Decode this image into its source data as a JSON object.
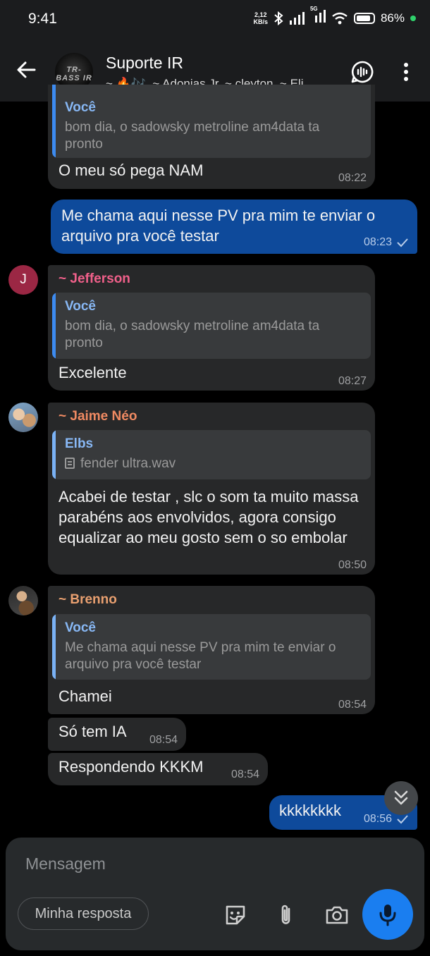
{
  "status_bar": {
    "time": "9:41",
    "net_speed_value": "2,12",
    "net_speed_unit": "KB/s",
    "network": "5G",
    "battery_percent": "86%",
    "battery_level": 0.86
  },
  "header": {
    "title": "Suporte IR",
    "members": "~ 🔥🎶, ~ Adonias Jr, ~ cleyton, ~ Eli...",
    "avatar_text": "TR-BASS IR"
  },
  "messages": [
    {
      "reply_author": "Você",
      "reply_text": "bom dia, o sadowsky metroline am4data ta pronto",
      "text": "O meu só pega NAM",
      "time": "08:22"
    },
    {
      "text": "Me chama aqui nesse PV pra mim te enviar o arquivo pra você testar",
      "time": "08:23"
    },
    {
      "sender": "~ Jefferson",
      "avatar_initial": "J",
      "reply_author": "Você",
      "reply_text": "bom dia, o sadowsky metroline am4data ta pronto",
      "text": "Excelente",
      "time": "08:27"
    },
    {
      "sender": "~ Jaime Néo",
      "reply_author": "Elbs",
      "reply_text": "fender ultra.wav",
      "text": "Acabei de testar , slc o som ta muito massa parabéns aos envolvidos, agora consigo equalizar ao meu gosto sem o so embolar",
      "time": "08:50"
    },
    {
      "sender": "~ Brenno",
      "reply_author": "Você",
      "reply_text": "Me chama aqui nesse PV pra mim te enviar o arquivo pra você testar",
      "text": "Chamei",
      "time": "08:54"
    },
    {
      "text": "Só tem IA",
      "time": "08:54"
    },
    {
      "text": "Respondendo KKKM",
      "time": "08:54"
    },
    {
      "text": "kkkkkkkk",
      "time": "08:56"
    }
  ],
  "composer": {
    "placeholder": "Mensagem",
    "quick_reply": "Minha resposta"
  },
  "colors": {
    "incoming_bubble": "#272829",
    "outgoing_bubble": "#0e4a9b",
    "jefferson": "#f0608a",
    "jaime": "#f08a62",
    "brenno": "#e9a070",
    "accent": "#1a7ef0"
  },
  "icons": {
    "back": "arrow-left-icon",
    "voice_chat": "voice-chat-icon",
    "menu": "more-vertical-icon",
    "scroll_down": "double-chevron-down-icon",
    "sticker": "sticker-icon",
    "attach": "paperclip-icon",
    "camera": "camera-icon",
    "mic": "microphone-icon"
  }
}
